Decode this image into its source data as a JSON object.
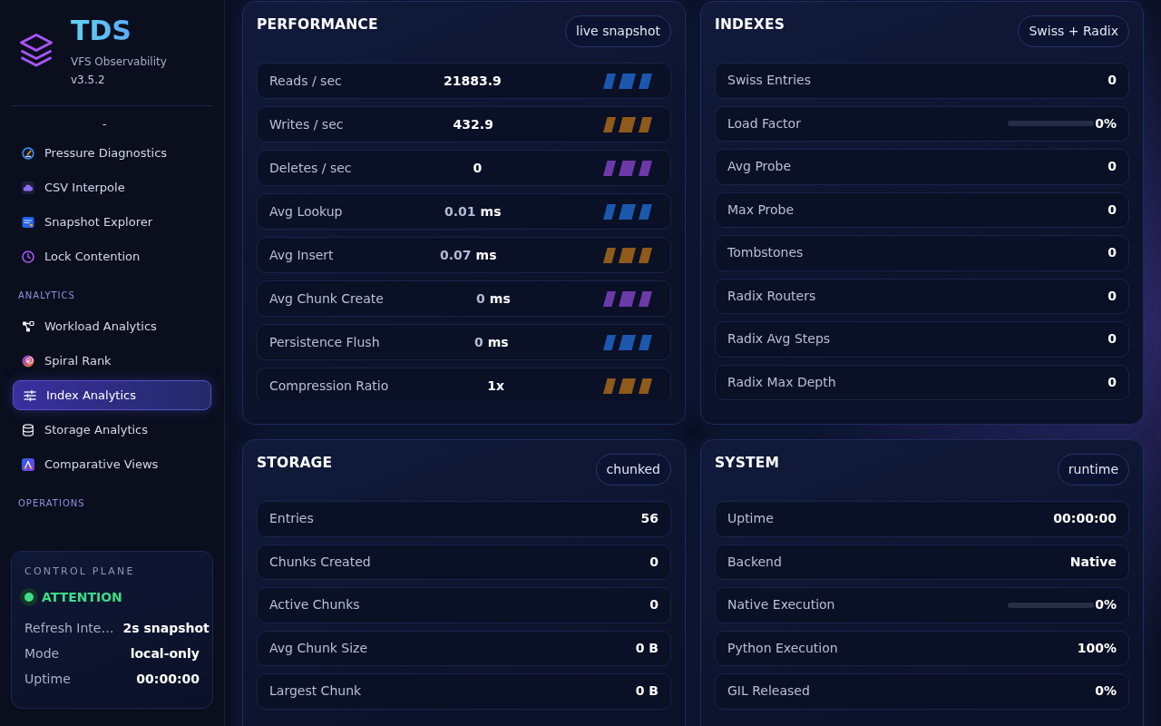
{
  "sidebar": {
    "brand": {
      "name": "TDS",
      "subtitle": "VFS Observability",
      "version": "v3.5.2"
    },
    "status": "-",
    "groups": [
      {
        "items": [
          {
            "label": "Pressure Diagnostics",
            "selected": false
          },
          {
            "label": "CSV Interpole",
            "selected": false
          },
          {
            "label": "Snapshot Explorer",
            "selected": false
          },
          {
            "label": "Lock Contention",
            "selected": false
          }
        ]
      },
      {
        "title": "ANALYTICS",
        "items": [
          {
            "label": "Workload Analytics",
            "selected": false
          },
          {
            "label": "Spiral Rank",
            "selected": false
          },
          {
            "label": "Index Analytics",
            "selected": true
          },
          {
            "label": "Storage Analytics",
            "selected": false
          },
          {
            "label": "Comparative Views",
            "selected": false
          }
        ]
      },
      {
        "title": "OPERATIONS"
      }
    ],
    "control_plane": {
      "title": "CONTROL PLANE",
      "status": {
        "label": "ATTENTION",
        "kind": "healthy"
      },
      "rows": [
        {
          "label": "Refresh Inte…",
          "value": "2s snapshot"
        },
        {
          "label": "Mode",
          "value": "local-only"
        },
        {
          "label": "Uptime",
          "value": "00:00:00"
        }
      ]
    }
  },
  "panels": [
    {
      "title": "PERFORMANCE",
      "badge": "live snapshot",
      "rows": [
        {
          "kind": "rate",
          "label": "Reads / sec",
          "value": "21883.9",
          "color": "#1b58ad"
        },
        {
          "kind": "rate",
          "label": "Writes / sec",
          "value": "432.9",
          "color": "#8f5a1a"
        },
        {
          "kind": "rate",
          "label": "Deletes / sec",
          "value": "0",
          "color": "#6c3aa8"
        },
        {
          "kind": "rate",
          "label": "Avg Lookup",
          "value": "0.01",
          "unit": "ms",
          "color": "#1b58ad"
        },
        {
          "kind": "rate",
          "label": "Avg Insert",
          "value": "0.07",
          "unit": "ms",
          "color": "#8f5a1a"
        },
        {
          "kind": "rate",
          "label": "Avg Chunk Create",
          "value": "0",
          "unit": "ms",
          "color": "#6c3aa8"
        },
        {
          "kind": "rate",
          "label": "Persistence Flush",
          "value": "0",
          "unit": "ms",
          "color": "#1b58ad"
        },
        {
          "kind": "rate",
          "label": "Compression Ratio",
          "value": "1x",
          "color": "#8f5a1a"
        }
      ]
    },
    {
      "title": "INDEXES",
      "badge": "Swiss + Radix",
      "rows": [
        {
          "kind": "stat",
          "label": "Swiss Entries",
          "value": "0"
        },
        {
          "kind": "gauge",
          "label": "Load Factor",
          "value": "0%",
          "level": 0
        },
        {
          "kind": "stat",
          "label": "Avg Probe",
          "value": "0"
        },
        {
          "kind": "stat",
          "label": "Max Probe",
          "value": "0"
        },
        {
          "kind": "stat",
          "label": "Tombstones",
          "value": "0"
        },
        {
          "kind": "stat",
          "label": "Radix Routers",
          "value": "0"
        },
        {
          "kind": "stat",
          "label": "Radix Avg Steps",
          "value": "0"
        },
        {
          "kind": "stat",
          "label": "Radix Max Depth",
          "value": "0"
        }
      ]
    },
    {
      "title": "STORAGE",
      "badge": "chunked",
      "rows": [
        {
          "kind": "stat",
          "label": "Entries",
          "value": "56"
        },
        {
          "kind": "stat",
          "label": "Chunks Created",
          "value": "0"
        },
        {
          "kind": "stat",
          "label": "Active Chunks",
          "value": "0"
        },
        {
          "kind": "stat",
          "label": "Avg Chunk Size",
          "value": "0 B"
        },
        {
          "kind": "stat",
          "label": "Largest Chunk",
          "value": "0 B"
        }
      ]
    },
    {
      "title": "SYSTEM",
      "badge": "runtime",
      "rows": [
        {
          "kind": "stat",
          "label": "Uptime",
          "value": "00:00:00"
        },
        {
          "kind": "stat",
          "label": "Backend",
          "value": "Native"
        },
        {
          "kind": "gauge",
          "label": "Native Execution",
          "value": "0%",
          "level": 0
        },
        {
          "kind": "stat",
          "label": "Python Execution",
          "value": "100%"
        },
        {
          "kind": "stat",
          "label": "GIL Released",
          "value": "0%"
        }
      ]
    }
  ]
}
